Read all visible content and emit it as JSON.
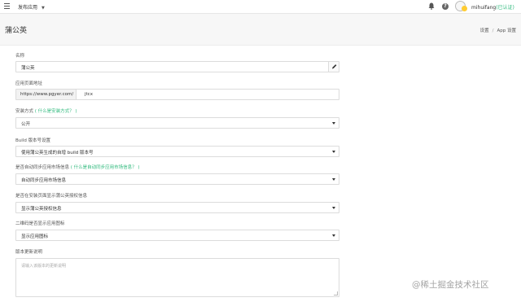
{
  "topbar": {
    "app_selector": "发布应用",
    "user_name": "mihuifang",
    "user_status": "(已认证)"
  },
  "page": {
    "title": "蒲公英",
    "breadcrumb": [
      "设置",
      "App 设置"
    ]
  },
  "form": {
    "name": {
      "label": "名称",
      "value": "蒲公英"
    },
    "url": {
      "label": "应用页面地址",
      "prefix": "https://www.pgyer.com/",
      "value": "jtcx"
    },
    "install": {
      "label": "安装方式",
      "hint": "( 什么是安装方式？ )",
      "value": "公开"
    },
    "build": {
      "label": "Build 版本号设置",
      "value": "使用蒲公英生成的自增 build 版本号"
    },
    "sync": {
      "label": "是否自动同步应用市场信息",
      "hint": "( 什么是自动同步应用市场信息？ )",
      "value": "自动同步应用市场信息"
    },
    "permission": {
      "label": "是否在安装页面显示蒲公英授权信息",
      "value": "显示蒲公英授权信息"
    },
    "qrcode": {
      "label": "二维码是否显示应用图标",
      "value": "显示应用图标"
    },
    "changelog": {
      "label": "版本更新说明",
      "placeholder": "请输入该版本的更新说明"
    }
  },
  "watermark": "@稀土掘金技术社区",
  "colors": {
    "accent_green": "#2eb97c",
    "header_bg": "#f7f7f7",
    "border": "#dcdcdc"
  }
}
